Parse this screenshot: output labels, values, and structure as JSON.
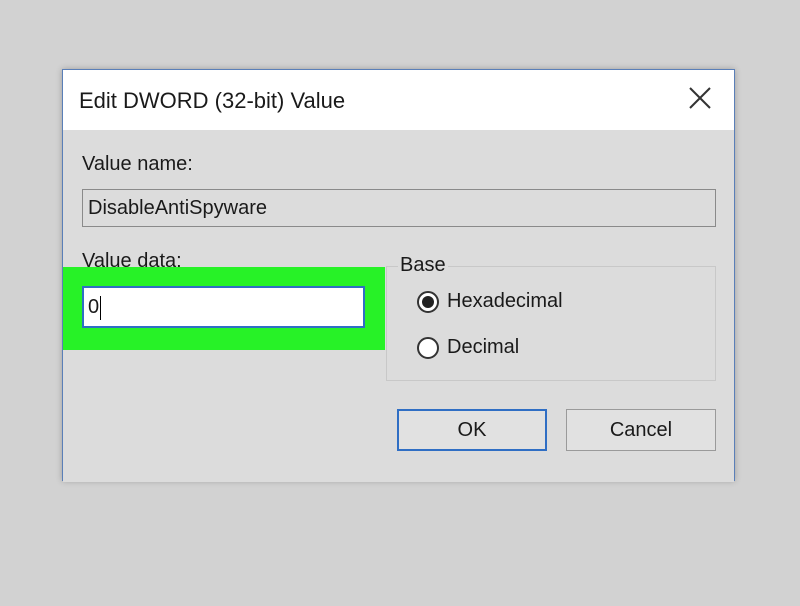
{
  "dialog": {
    "title": "Edit DWORD (32-bit) Value",
    "close_icon": "close-icon"
  },
  "value_name": {
    "label": "Value name:",
    "value": "DisableAntiSpyware"
  },
  "value_data": {
    "label": "Value data:",
    "value": "0"
  },
  "base": {
    "legend": "Base",
    "options": [
      {
        "label": "Hexadecimal",
        "selected": true
      },
      {
        "label": "Decimal",
        "selected": false
      }
    ]
  },
  "buttons": {
    "ok": "OK",
    "cancel": "Cancel"
  },
  "colors": {
    "highlight": "#27f227",
    "focus_border": "#2f6ec4"
  }
}
